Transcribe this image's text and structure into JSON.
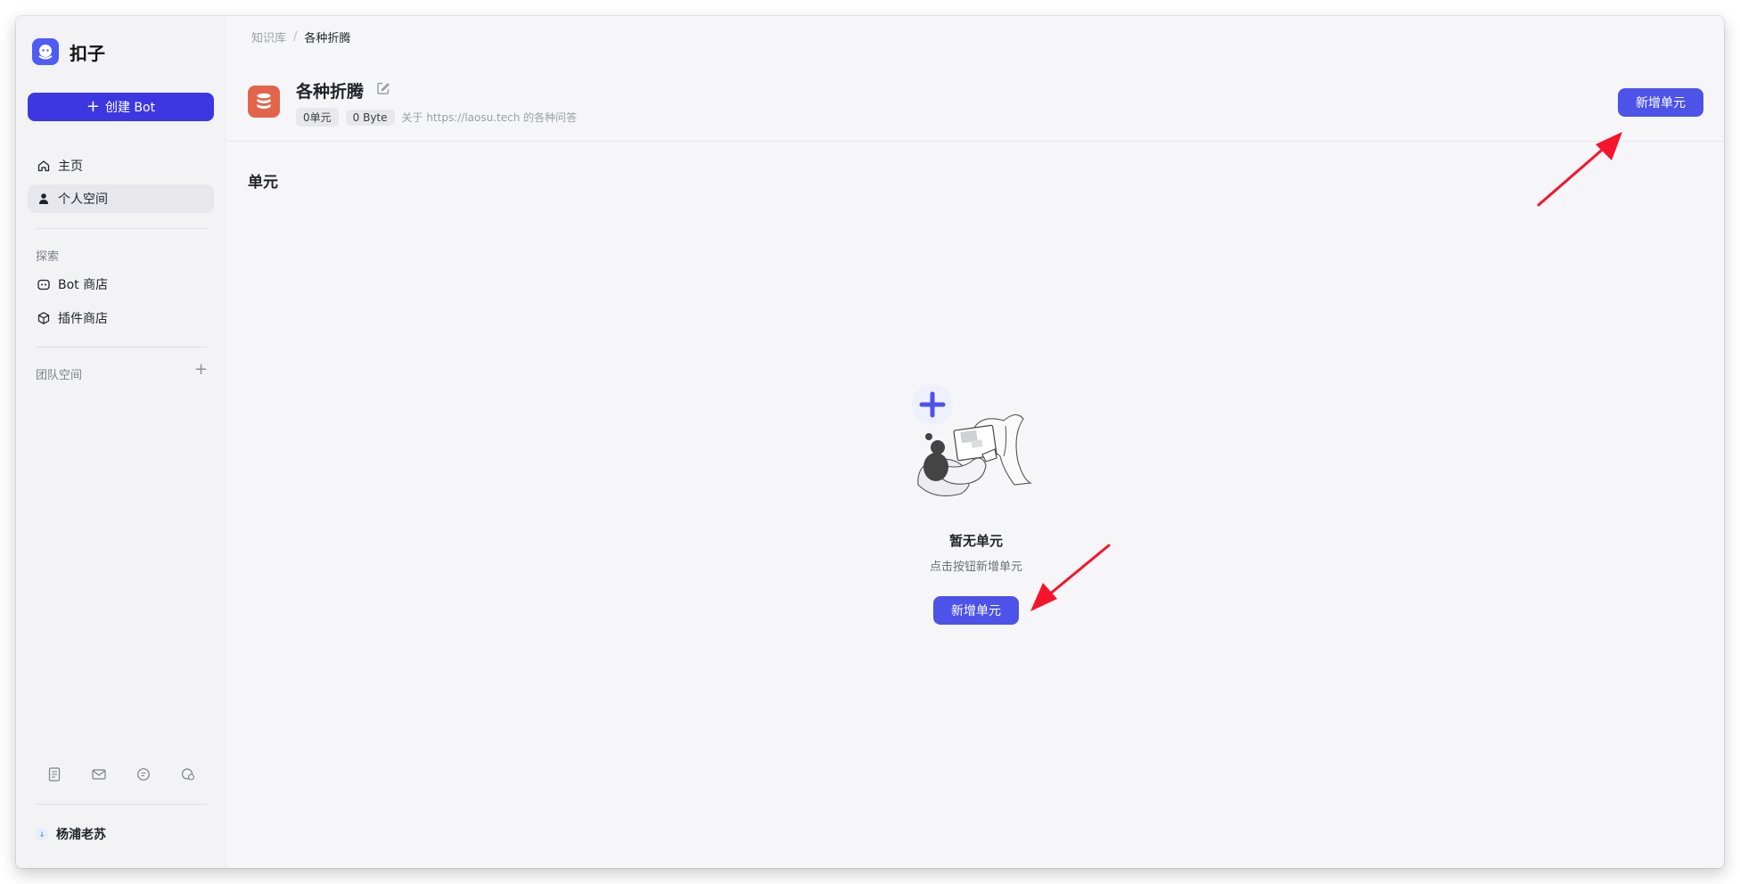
{
  "app": {
    "name": "扣子"
  },
  "sidebar": {
    "create_label": "创建 Bot",
    "nav": [
      {
        "label": "主页",
        "icon": "home-icon"
      },
      {
        "label": "个人空间",
        "icon": "user-icon",
        "active": true
      }
    ],
    "explore_label": "探索",
    "explore_items": [
      {
        "label": "Bot 商店",
        "icon": "bot-icon"
      },
      {
        "label": "插件商店",
        "icon": "cube-icon"
      }
    ],
    "team_label": "团队空间",
    "footer_icons": [
      "document-icon",
      "mail-icon",
      "chat-icon",
      "feedback-icon"
    ],
    "user_name": "杨浦老苏"
  },
  "breadcrumb": {
    "parent": "知识库",
    "separator": "/",
    "current": "各种折腾"
  },
  "knowledge": {
    "title": "各种折腾",
    "unit_count": "0单元",
    "size": "0 Byte",
    "description": "关于 https://laosu.tech 的各种问答"
  },
  "actions": {
    "add_unit": "新增单元"
  },
  "content": {
    "section_title": "单元",
    "empty_title": "暂无单元",
    "empty_hint": "点击按钮新增单元",
    "empty_button": "新增单元"
  },
  "colors": {
    "primary": "#4d53e8",
    "create_button": "#3d37e2",
    "kb_icon": "#e2644b",
    "annotation_arrow": "#f5142b"
  }
}
